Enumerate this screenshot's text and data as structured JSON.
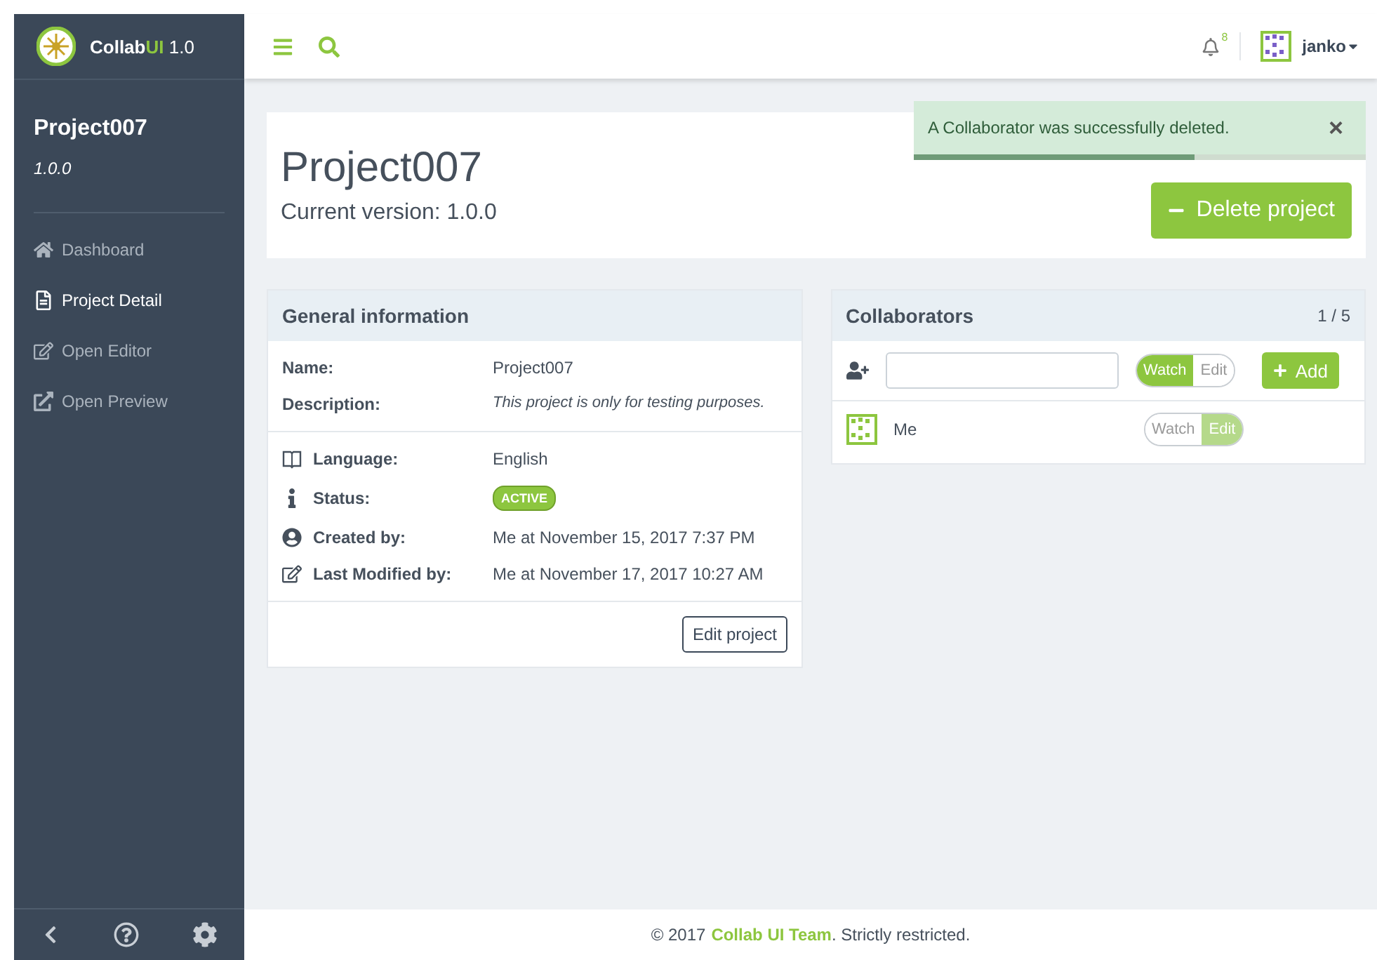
{
  "sidebar": {
    "logo": {
      "name": "Collab",
      "accent": "UI",
      "version": "1.0"
    },
    "project": {
      "title": "Project007",
      "version": "1.0.0"
    },
    "items": [
      {
        "label": "Dashboard",
        "kind": "home",
        "selected": false
      },
      {
        "label": "Project Detail",
        "kind": "doc",
        "selected": true
      },
      {
        "label": "Open Editor",
        "kind": "edit",
        "selected": false
      },
      {
        "label": "Open Preview",
        "kind": "external",
        "selected": false
      }
    ]
  },
  "topbar": {
    "notifications": "8",
    "user": "janko"
  },
  "toast": {
    "message": "A Collaborator was successfully deleted.",
    "close": "×",
    "level": 0.62
  },
  "header": {
    "title": "Project007",
    "subtitle": "Current version: 1.0.0",
    "delete_button": "Delete project"
  },
  "general": {
    "title": "General information",
    "rows": [
      {
        "label": "Name:",
        "value": "Project007",
        "kind": "plain"
      },
      {
        "label": "Description:",
        "value": "This project is only for testing purposes.",
        "kind": "italic"
      }
    ],
    "details": [
      {
        "label": "Language:",
        "value": "English",
        "kind": "plain"
      },
      {
        "label": "Status:",
        "value": "ACTIVE",
        "kind": "badge"
      },
      {
        "label": "Created by:",
        "value": "Me at November 15, 2017 7:37 PM",
        "kind": "plain"
      },
      {
        "label": "Last Modified by:",
        "value": "Me at November 17, 2017 10:27 AM",
        "kind": "plain"
      }
    ],
    "edit_button": "Edit project"
  },
  "collaborators": {
    "title": "Collaborators",
    "count": "1 / 5",
    "add_button": "Add",
    "new_roles": [
      {
        "label": "Watch",
        "selected": true
      },
      {
        "label": "Edit",
        "selected": false
      }
    ],
    "members": [
      {
        "name": "Me",
        "roles": [
          {
            "label": "Watch",
            "selected": false
          },
          {
            "label": "Edit",
            "selected": true
          }
        ]
      }
    ]
  },
  "footer": {
    "prefix": "© 2017",
    "team": "Collab UI Team",
    "suffix": ". Strictly restricted."
  }
}
